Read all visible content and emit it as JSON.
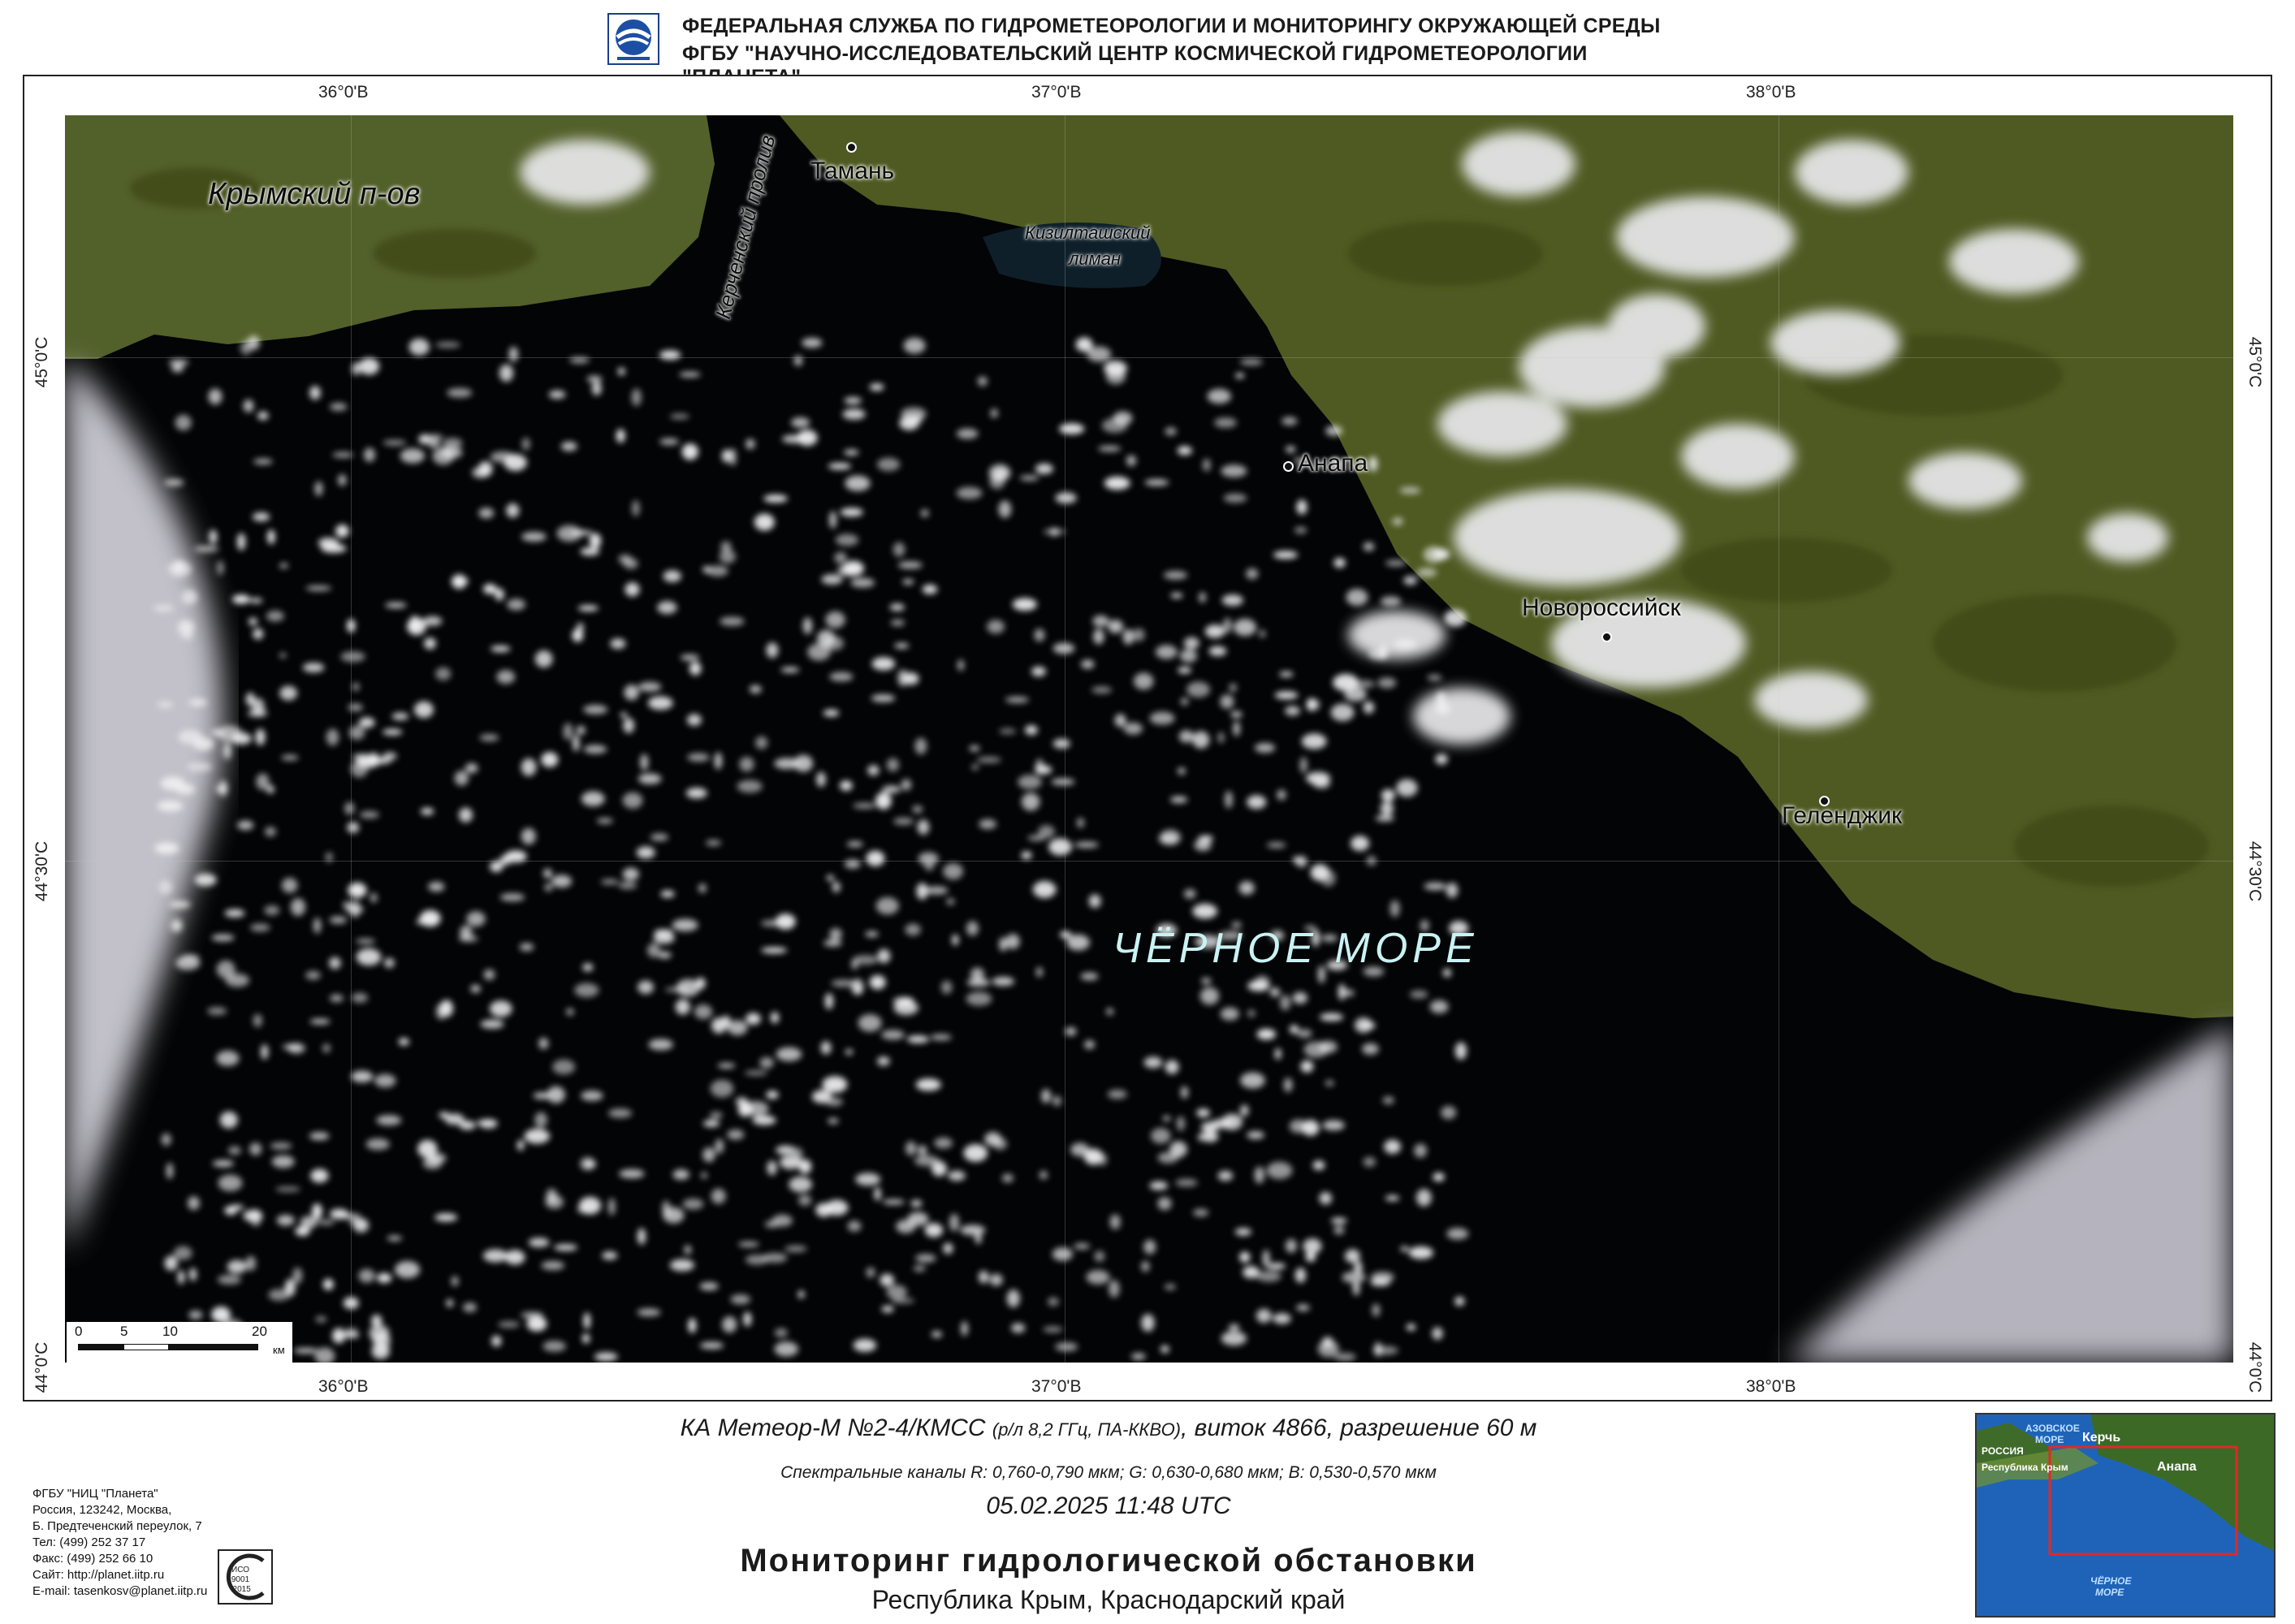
{
  "header": {
    "line1": "ФЕДЕРАЛЬНАЯ СЛУЖБА  ПО ГИДРОМЕТЕОРОЛОГИИ И МОНИТОРИНГУ ОКРУЖАЮЩЕЙ СРЕДЫ",
    "line2": "ФГБУ  \"НАУЧНО-ИССЛЕДОВАТЕЛЬСКИЙ ЦЕНТР КОСМИЧЕСКОЙ ГИДРОМЕТЕОРОЛОГИИ \"ПЛАНЕТА\"",
    "logo_icon": "roshydromet-logo-icon"
  },
  "map": {
    "longitude_labels": [
      "36°0'В",
      "37°0'В",
      "38°0'В"
    ],
    "latitude_labels": [
      "45°0'С",
      "44°30'С",
      "44°0'С"
    ],
    "place_labels": {
      "crimea": "Крымский п-ов",
      "kerch_strait": "Керченский пролив",
      "taman": "Тамань",
      "kiziltash_1": "Кизилташский",
      "kiziltash_2": "лиман",
      "anapa": "Анапа",
      "novorossiysk": "Новороссийск",
      "gelendzhik": "Геленджик"
    },
    "sea_label": "ЧЁРНОЕ МОРЕ",
    "scale_bar": {
      "ticks": [
        "0",
        "5",
        "10",
        "20"
      ],
      "unit": "км"
    },
    "colors": {
      "sea": "#030405",
      "land": "#4f5a22",
      "cloud": "#e8e8ea"
    }
  },
  "footer": {
    "satellite_main": "КА Метеор-М №2-4/КМСС ",
    "satellite_small": "(р/л 8,2 ГГц, ПА-ККВО)",
    "satellite_tail": ", виток 4866, разрешение 60 м",
    "spectral": "Спектральные каналы R: 0,760-0,790 мкм; G: 0,630-0,680 мкм; B: 0,530-0,570 мкм",
    "datetime": "05.02.2025  11:48 UTC",
    "title": "Мониторинг гидрологической обстановки",
    "region": "Республика Крым, Краснодарский край"
  },
  "contacts": [
    "ФГБУ \"НИЦ \"Планета\"",
    "Россия, 123242, Москва,",
    "Б. Предтеченский переулок, 7",
    "Тел: (499) 252 37 17",
    "Факс: (499) 252 66 10",
    "Сайт: http://planet.iitp.ru",
    "E-mail: tasenkosv@planet.iitp.ru"
  ],
  "iso_badge": {
    "line1": "ИСО",
    "line2": "9001",
    "line3": "-2015"
  },
  "inset": {
    "azov_1": "АЗОВСКОЕ",
    "azov_2": "МОРЕ",
    "kerch": "Керчь",
    "russia": "РОССИЯ",
    "crimea_rep": "Республика Крым",
    "anapa": "Анапа",
    "black_1": "ЧЁРНОЕ",
    "black_2": "МОРЕ"
  }
}
